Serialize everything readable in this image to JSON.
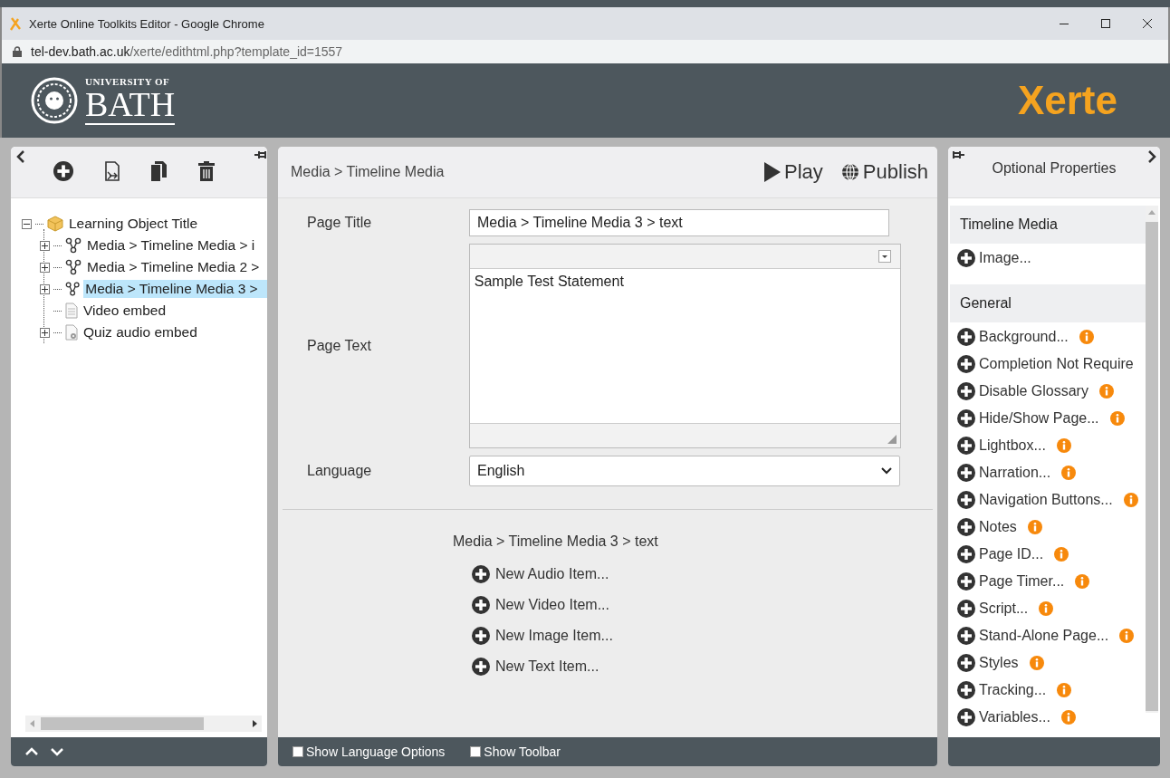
{
  "window": {
    "title": "Xerte Online Toolkits Editor - Google Chrome",
    "url_host": "tel-dev.bath.ac.uk",
    "url_path": "/xerte/edithtml.php?template_id=1557"
  },
  "header": {
    "university_small": "UNIVERSITY OF",
    "university_large": "BATH",
    "product": "Xerte"
  },
  "tree": {
    "items": [
      {
        "label": "Learning Object Title",
        "kind": "project",
        "expanded": true,
        "selected": false,
        "children": [
          {
            "label": "Media > Timeline Media > i",
            "kind": "timeline",
            "expanded": false,
            "selected": false
          },
          {
            "label": "Media > Timeline Media 2 >",
            "kind": "timeline",
            "expanded": false,
            "selected": false
          },
          {
            "label": "Media > Timeline Media 3 >",
            "kind": "timeline",
            "expanded": false,
            "selected": true
          },
          {
            "label": "Video embed",
            "kind": "page"
          },
          {
            "label": "Quiz audio embed",
            "kind": "quiz",
            "expanded": false,
            "selected": false
          }
        ]
      }
    ]
  },
  "editor": {
    "breadcrumb": "Media > Timeline Media",
    "play": "Play",
    "publish": "Publish",
    "fields": [
      {
        "kind": "input",
        "label": "Page Title",
        "value": "Media > Timeline Media 3 > text"
      },
      {
        "kind": "richtext",
        "label": "Page Text",
        "value": "Sample Test Statement"
      },
      {
        "kind": "select",
        "label": "Language",
        "value": "English"
      }
    ],
    "children_heading": "Media > Timeline Media 3 > text",
    "new_items": [
      "New Audio Item...",
      "New Video Item...",
      "New Image Item...",
      "New Text Item..."
    ],
    "options": [
      {
        "label": "Show Language Options",
        "checked": false
      },
      {
        "label": "Show Toolbar",
        "checked": false
      }
    ]
  },
  "properties": {
    "title": "Optional Properties",
    "sections": [
      {
        "title": "Timeline Media",
        "items": [
          {
            "label": "Image...",
            "info": false
          }
        ]
      },
      {
        "title": "General",
        "items": [
          {
            "label": "Background...",
            "info": true
          },
          {
            "label": "Completion Not Require",
            "info": false
          },
          {
            "label": "Disable Glossary",
            "info": true
          },
          {
            "label": "Hide/Show Page...",
            "info": true
          },
          {
            "label": "Lightbox...",
            "info": true
          },
          {
            "label": "Narration...",
            "info": true
          },
          {
            "label": "Navigation Buttons...",
            "info": true
          },
          {
            "label": "Notes",
            "info": true
          },
          {
            "label": "Page ID...",
            "info": true
          },
          {
            "label": "Page Timer...",
            "info": true
          },
          {
            "label": "Script...",
            "info": true
          },
          {
            "label": "Stand-Alone Page...",
            "info": true
          },
          {
            "label": "Styles",
            "info": true
          },
          {
            "label": "Tracking...",
            "info": true
          },
          {
            "label": "Variables...",
            "info": true
          }
        ]
      }
    ]
  }
}
